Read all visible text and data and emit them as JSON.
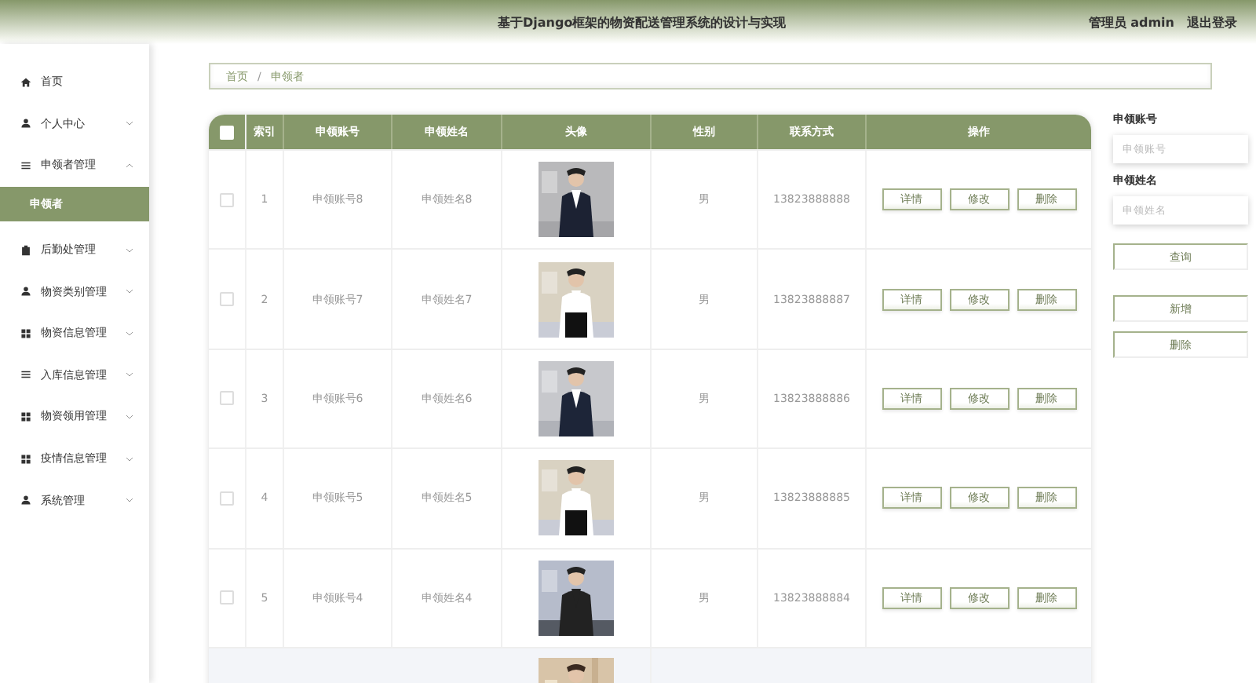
{
  "header": {
    "title": "基于Django框架的物资配送管理系统的设计与实现",
    "user": "管理员 admin",
    "logout": "退出登录"
  },
  "sidebar": {
    "items": [
      {
        "label": "首页",
        "kind": "home"
      },
      {
        "label": "个人中心",
        "kind": "user",
        "expanded": false
      },
      {
        "label": "申领者管理",
        "kind": "list",
        "expanded": true,
        "children": [
          {
            "label": "申领者",
            "selected": true
          }
        ]
      },
      {
        "label": "后勤处管理",
        "kind": "clip",
        "expanded": false
      },
      {
        "label": "物资类别管理",
        "kind": "user",
        "expanded": false
      },
      {
        "label": "物资信息管理",
        "kind": "grid",
        "expanded": false
      },
      {
        "label": "入库信息管理",
        "kind": "list",
        "expanded": false
      },
      {
        "label": "物资领用管理",
        "kind": "grid",
        "expanded": false
      },
      {
        "label": "疫情信息管理",
        "kind": "grid",
        "expanded": false
      },
      {
        "label": "系统管理",
        "kind": "user",
        "expanded": false
      }
    ]
  },
  "breadcrumb": {
    "items": [
      "首页",
      "申领者"
    ],
    "separator": "/"
  },
  "table": {
    "all_checked": false,
    "columns": [
      "索引",
      "申领账号",
      "申领姓名",
      "头像",
      "性别",
      "联系方式",
      "操作"
    ],
    "rows": [
      {
        "index": "1",
        "account": "申领账号8",
        "name": "申领姓名8",
        "gender": "男",
        "phone": "13823888888",
        "checked": false,
        "hovered": false,
        "actions": [
          "详情",
          "修改",
          "删除"
        ]
      },
      {
        "index": "2",
        "account": "申领账号7",
        "name": "申领姓名7",
        "gender": "男",
        "phone": "13823888887",
        "checked": false,
        "hovered": false,
        "actions": [
          "详情",
          "修改",
          "删除"
        ]
      },
      {
        "index": "3",
        "account": "申领账号6",
        "name": "申领姓名6",
        "gender": "男",
        "phone": "13823888886",
        "checked": false,
        "hovered": false,
        "actions": [
          "详情",
          "修改",
          "删除"
        ]
      },
      {
        "index": "4",
        "account": "申领账号5",
        "name": "申领姓名5",
        "gender": "男",
        "phone": "13823888885",
        "checked": false,
        "hovered": false,
        "actions": [
          "详情",
          "修改",
          "删除"
        ]
      },
      {
        "index": "5",
        "account": "申领账号4",
        "name": "申领姓名4",
        "gender": "男",
        "phone": "13823888884",
        "checked": false,
        "hovered": false,
        "actions": [
          "详情",
          "修改",
          "删除"
        ]
      }
    ],
    "partial_row": {
      "hovered": true
    }
  },
  "search": {
    "fields": [
      {
        "label": "申领账号",
        "placeholder": "申领账号"
      },
      {
        "label": "申领姓名",
        "placeholder": "申领姓名"
      }
    ],
    "query": "查询",
    "add": "新增",
    "delete": "删除"
  }
}
